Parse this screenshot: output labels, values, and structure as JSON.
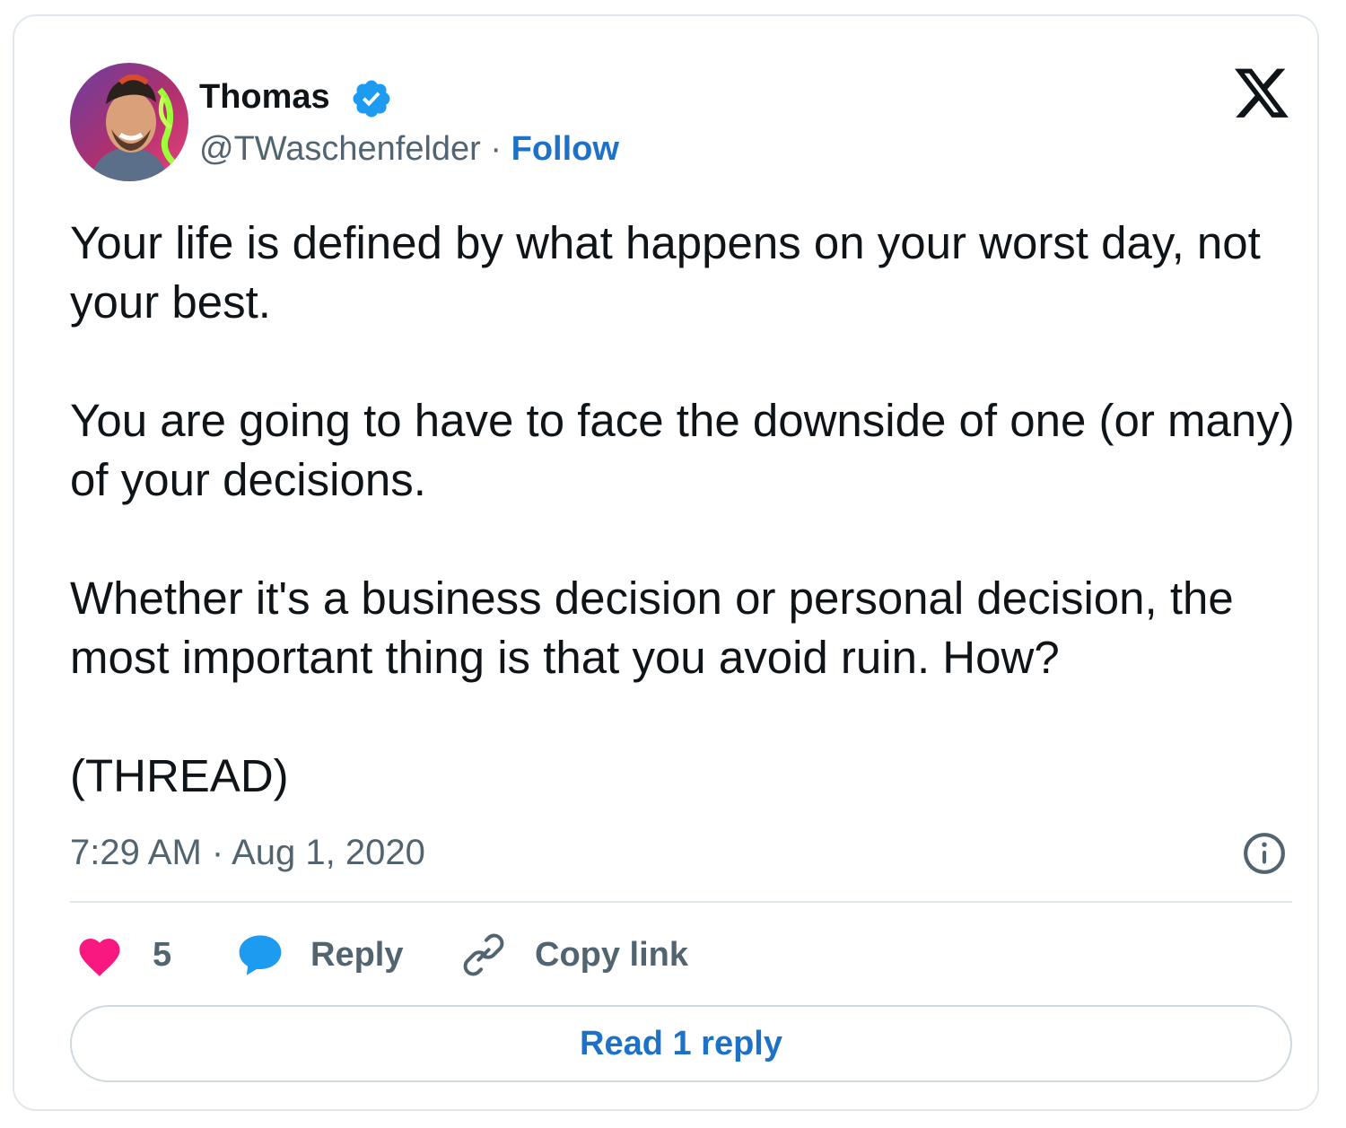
{
  "author": {
    "name": "Thomas",
    "handle": "@TWaschenfelder",
    "separator": " · ",
    "follow_label": "Follow",
    "verified": true
  },
  "tweet": {
    "paragraphs": [
      "Your life is defined by what happens on your worst day, not your best.",
      "You are going to have to face the downside of one (or many) of your decisions.",
      "Whether it's a business decision or personal decision, the most important thing is that you avoid ruin. How?",
      "(THREAD)"
    ],
    "timestamp": "7:29 AM · Aug 1, 2020"
  },
  "actions": {
    "like_count": "5",
    "reply_label": "Reply",
    "copy_link_label": "Copy link"
  },
  "read_replies_label": "Read 1 reply",
  "icons": {
    "platform": "x-logo-icon",
    "verified": "verified-badge-icon",
    "info": "info-icon",
    "like": "heart-icon",
    "reply": "speech-bubble-icon",
    "copy": "link-icon"
  },
  "colors": {
    "link_blue": "#1d72c8",
    "verified_blue": "#1d9bf0",
    "heart_pink": "#f91880",
    "text": "#0f1419",
    "muted": "#536471",
    "border": "#e1e8ed"
  }
}
